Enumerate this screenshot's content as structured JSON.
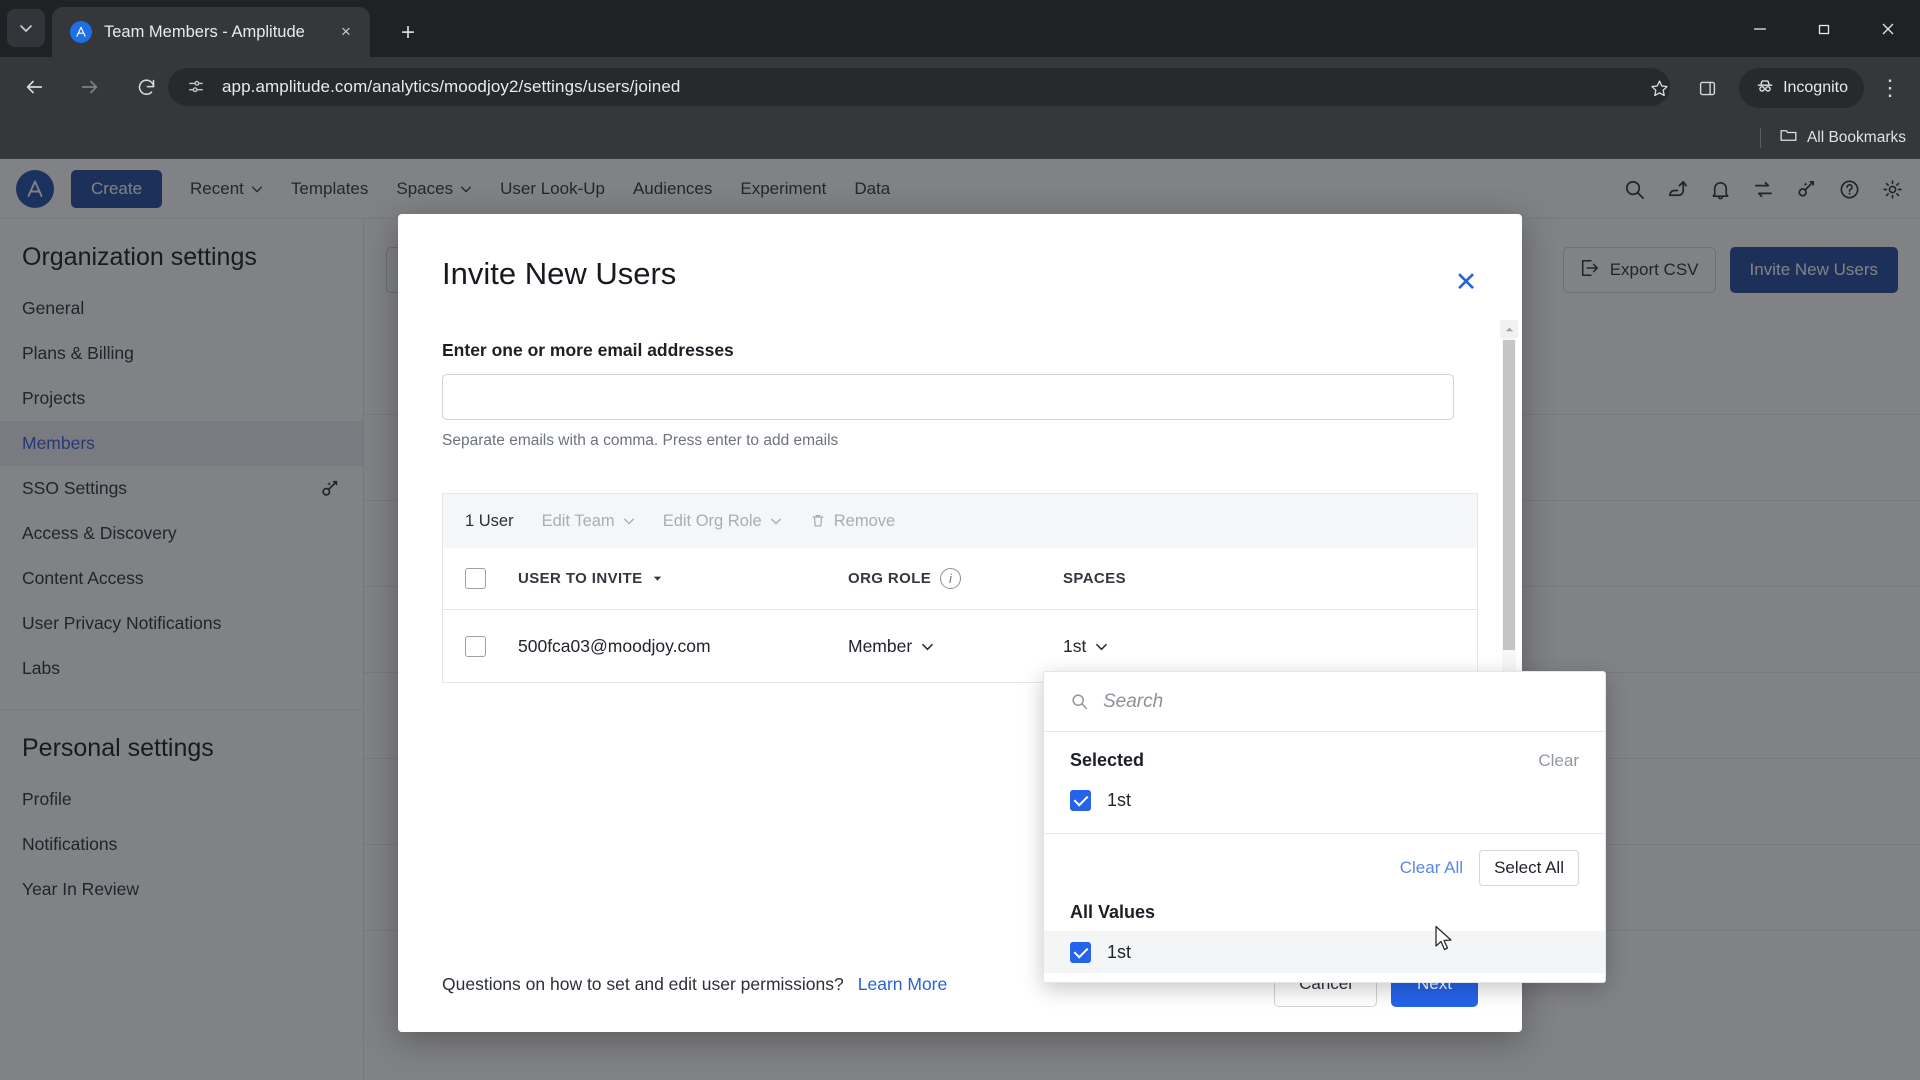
{
  "browser": {
    "tab": {
      "title": "Team Members - Amplitude",
      "favicon": "amplitude-logo-icon"
    },
    "new_tab_label": "+",
    "tab_list_icon": "chevron-down-icon",
    "close_icon": "×",
    "window": {
      "minimize": "–",
      "maximize": "❐",
      "close": "✕"
    },
    "nav": {
      "back": "←",
      "forward": "→",
      "reload": "⟳"
    },
    "omnibox": {
      "url": "app.amplitude.com/analytics/moodjoy2/settings/users/joined",
      "site_icon": "site-settings-icon",
      "star_icon": "☆",
      "sidepanel_icon": "side-panel-icon"
    },
    "incognito": {
      "label": "Incognito",
      "icon": "incognito-icon"
    },
    "menu_icon": "⋮",
    "bookmarks": {
      "all_label": "All Bookmarks",
      "folder_icon": "folder-icon"
    }
  },
  "app": {
    "logo_text": "A",
    "create_label": "Create",
    "nav_links": [
      {
        "label": "Recent",
        "caret": true
      },
      {
        "label": "Templates",
        "caret": false
      },
      {
        "label": "Spaces",
        "caret": true
      },
      {
        "label": "User Look-Up",
        "caret": false
      },
      {
        "label": "Audiences",
        "caret": false
      },
      {
        "label": "Experiment",
        "caret": false
      },
      {
        "label": "Data",
        "caret": false
      }
    ],
    "nav_icons": [
      "search-icon",
      "insights-icon",
      "bell-icon",
      "compare-icon",
      "magic-key-icon",
      "help-icon",
      "gear-icon"
    ]
  },
  "sidebar": {
    "org_heading": "Organization settings",
    "org_items": [
      {
        "label": "General",
        "active": false,
        "badge": null
      },
      {
        "label": "Plans & Billing",
        "active": false,
        "badge": null
      },
      {
        "label": "Projects",
        "active": false,
        "badge": null
      },
      {
        "label": "Members",
        "active": true,
        "badge": null
      },
      {
        "label": "SSO Settings",
        "active": false,
        "badge": "magic-key-icon"
      },
      {
        "label": "Access & Discovery",
        "active": false,
        "badge": null
      },
      {
        "label": "Content Access",
        "active": false,
        "badge": null
      },
      {
        "label": "User Privacy Notifications",
        "active": false,
        "badge": null
      },
      {
        "label": "Labs",
        "active": false,
        "badge": null
      }
    ],
    "personal_heading": "Personal settings",
    "personal_items": [
      {
        "label": "Profile"
      },
      {
        "label": "Notifications"
      },
      {
        "label": "Year In Review"
      }
    ]
  },
  "content": {
    "export_label": "Export CSV",
    "export_icon": "export-icon",
    "invite_label": "Invite New Users"
  },
  "modal": {
    "title": "Invite New Users",
    "close_icon": "✕",
    "email_label": "Enter one or more email addresses",
    "email_value": "",
    "email_placeholder": "",
    "email_help": "Separate emails with a comma. Press enter to add emails",
    "bulkbar": {
      "count": "1 User",
      "edit_team": "Edit Team",
      "edit_org_role": "Edit Org Role",
      "remove": "Remove",
      "trash_icon": "trash-icon"
    },
    "table": {
      "headers": [
        "USER TO INVITE",
        "ORG ROLE",
        "SPACES"
      ],
      "sort_icon": "caret-down-icon",
      "info_icon": "info-icon",
      "rows": [
        {
          "checked": false,
          "email": "500fca03@moodjoy.com",
          "org_role": "Member",
          "spaces": "1st"
        }
      ]
    },
    "footer": {
      "question": "Questions on how to set and edit user permissions?",
      "learn_more": "Learn More",
      "cancel": "Cancel",
      "next": "Next"
    }
  },
  "spaces_dropdown": {
    "search_placeholder": "Search",
    "search_icon": "search-icon",
    "selected_heading": "Selected",
    "clear_label": "Clear",
    "selected_items": [
      {
        "label": "1st",
        "checked": true
      }
    ],
    "clear_all_label": "Clear All",
    "select_all_label": "Select All",
    "all_values_heading": "All Values",
    "all_values_items": [
      {
        "label": "1st",
        "checked": true,
        "hovered": true
      }
    ]
  },
  "colors": {
    "accent_blue": "#2563eb",
    "brand_navy": "#1f4ba0",
    "link_blue": "#2563d6",
    "sidebar_active": "#3b5bdb"
  }
}
